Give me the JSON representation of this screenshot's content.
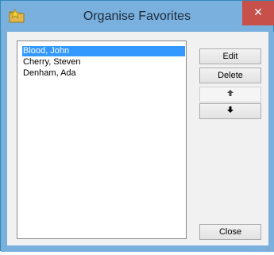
{
  "window": {
    "title": "Organise Favorites",
    "close_glyph": "✕",
    "icon": "folder-star-icon"
  },
  "favorites": {
    "items": [
      "Blood, John",
      "Cherry, Steven",
      "Denham, Ada"
    ],
    "selected_index": 0
  },
  "buttons": {
    "edit": "Edit",
    "delete": "Delete",
    "move_up": "🡅",
    "move_down": "🡇",
    "close": "Close"
  },
  "colors": {
    "titlebar": "#7ab0de",
    "close": "#c7504a",
    "selection": "#3399ff"
  }
}
